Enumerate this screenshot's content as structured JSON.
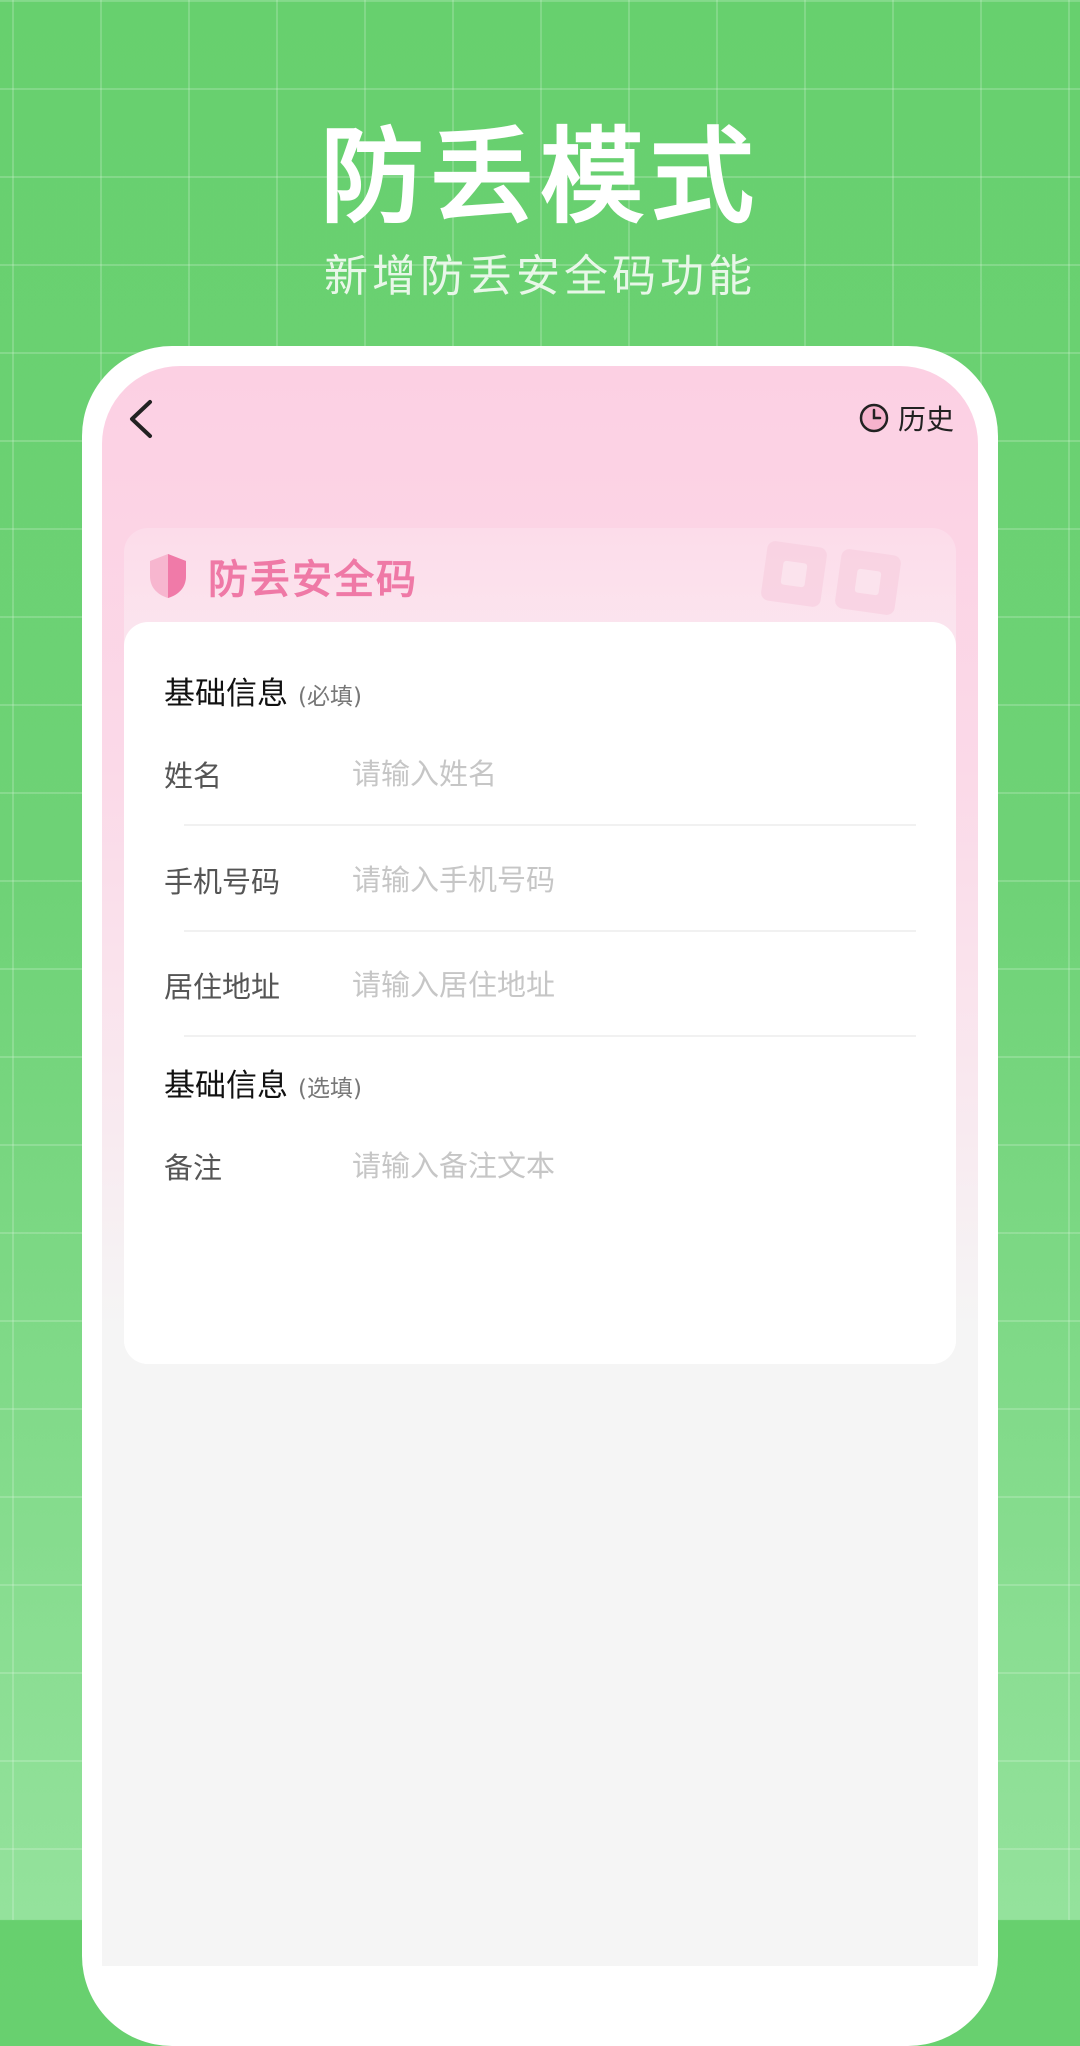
{
  "hero": {
    "title": "防丢模式",
    "subtitle": "新增防丢安全码功能"
  },
  "topbar": {
    "back_icon": "chevron-left-icon",
    "history_icon": "clock-icon",
    "history_label": "历史"
  },
  "card": {
    "title": "防丢安全码",
    "title_color": "#ef79a6",
    "required_section": {
      "title": "基础信息",
      "note": "(必填)",
      "fields": [
        {
          "label": "姓名",
          "placeholder": "请输入姓名",
          "value": ""
        },
        {
          "label": "手机号码",
          "placeholder": "请输入手机号码",
          "value": ""
        },
        {
          "label": "居住地址",
          "placeholder": "请输入居住地址",
          "value": ""
        }
      ]
    },
    "optional_section": {
      "title": "基础信息",
      "note": "(选填)",
      "fields": [
        {
          "label": "备注",
          "placeholder": "请输入备注文本",
          "value": ""
        }
      ]
    }
  },
  "colors": {
    "background": "#67d06e",
    "accent_pink": "#ef79a6",
    "screen_pink": "#fcd0e3"
  }
}
